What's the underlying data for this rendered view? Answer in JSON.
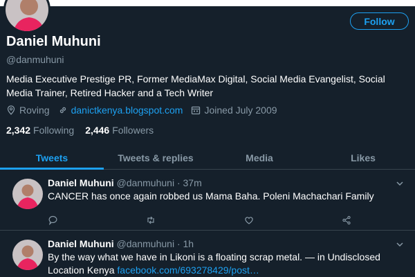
{
  "profile": {
    "name": "Daniel Muhuni",
    "handle": "@danmuhuni",
    "bio": "Media Executive Prestige PR, Former MediaMax Digital, Social Media Evangelist, Social Media Trainer, Retired Hacker and a Tech Writer",
    "location": "Roving",
    "website": "danictkenya.blogspot.com",
    "joined": "Joined July 2009",
    "follow_label": "Follow",
    "following_count": "2,342",
    "following_label": "Following",
    "followers_count": "2,446",
    "followers_label": "Followers"
  },
  "tabs": [
    {
      "label": "Tweets",
      "active": true
    },
    {
      "label": "Tweets & replies",
      "active": false
    },
    {
      "label": "Media",
      "active": false
    },
    {
      "label": "Likes",
      "active": false
    }
  ],
  "tweets": [
    {
      "name": "Daniel Muhuni",
      "handle": "@danmuhuni",
      "separator": "·",
      "time": "37m",
      "text": "CANCER has once again robbed us Mama Baha. Poleni Machachari Family"
    },
    {
      "name": "Daniel Muhuni",
      "handle": "@danmuhuni",
      "separator": "·",
      "time": "1h",
      "text": "By the way what we have in Likoni is a floating scrap metal. — in Undisclosed Location Kenya",
      "link": "facebook.com/693278429/post…"
    }
  ],
  "colors": {
    "background": "#15202b",
    "accent": "#1da1f2",
    "muted": "#8899a6",
    "border": "#38444d"
  },
  "icons": [
    "location-icon",
    "link-icon",
    "calendar-icon",
    "reply-icon",
    "retweet-icon",
    "like-icon",
    "share-icon",
    "chevron-down-icon"
  ]
}
